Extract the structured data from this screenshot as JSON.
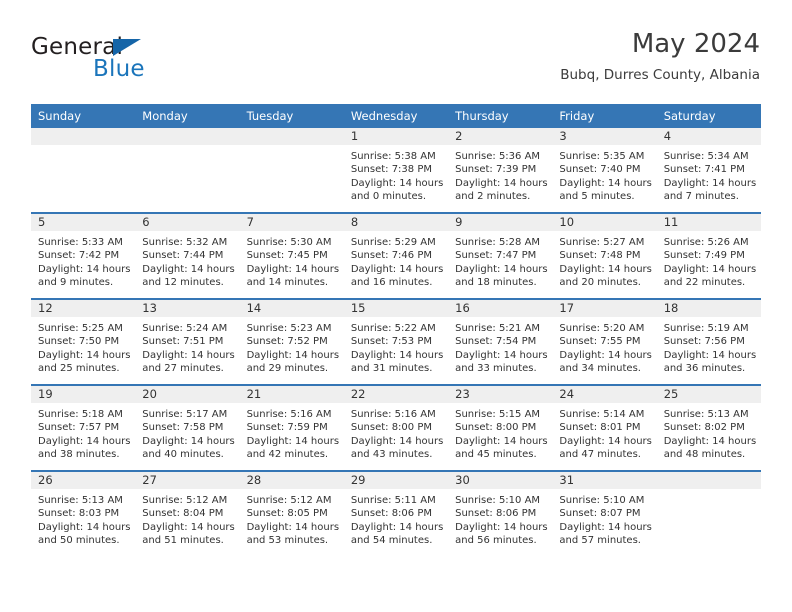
{
  "logo": {
    "word_one": "General",
    "word_two": "Blue",
    "triangle_color": "#1565a8",
    "blue_color": "#1b75bb"
  },
  "header": {
    "title": "May 2024",
    "subtitle": "Bubq, Durres County, Albania"
  },
  "theme": {
    "header_blue": "#3576b5",
    "daynum_gray": "#efefef",
    "text_color": "#333333"
  },
  "weekday_headers": [
    "Sunday",
    "Monday",
    "Tuesday",
    "Wednesday",
    "Thursday",
    "Friday",
    "Saturday"
  ],
  "weeks": [
    [
      {
        "day": "",
        "empty": true
      },
      {
        "day": "",
        "empty": true
      },
      {
        "day": "",
        "empty": true
      },
      {
        "day": "1",
        "sunrise": "Sunrise: 5:38 AM",
        "sunset": "Sunset: 7:38 PM",
        "daylight_line1": "Daylight: 14 hours",
        "daylight_line2": "and 0 minutes."
      },
      {
        "day": "2",
        "sunrise": "Sunrise: 5:36 AM",
        "sunset": "Sunset: 7:39 PM",
        "daylight_line1": "Daylight: 14 hours",
        "daylight_line2": "and 2 minutes."
      },
      {
        "day": "3",
        "sunrise": "Sunrise: 5:35 AM",
        "sunset": "Sunset: 7:40 PM",
        "daylight_line1": "Daylight: 14 hours",
        "daylight_line2": "and 5 minutes."
      },
      {
        "day": "4",
        "sunrise": "Sunrise: 5:34 AM",
        "sunset": "Sunset: 7:41 PM",
        "daylight_line1": "Daylight: 14 hours",
        "daylight_line2": "and 7 minutes."
      }
    ],
    [
      {
        "day": "5",
        "sunrise": "Sunrise: 5:33 AM",
        "sunset": "Sunset: 7:42 PM",
        "daylight_line1": "Daylight: 14 hours",
        "daylight_line2": "and 9 minutes."
      },
      {
        "day": "6",
        "sunrise": "Sunrise: 5:32 AM",
        "sunset": "Sunset: 7:44 PM",
        "daylight_line1": "Daylight: 14 hours",
        "daylight_line2": "and 12 minutes."
      },
      {
        "day": "7",
        "sunrise": "Sunrise: 5:30 AM",
        "sunset": "Sunset: 7:45 PM",
        "daylight_line1": "Daylight: 14 hours",
        "daylight_line2": "and 14 minutes."
      },
      {
        "day": "8",
        "sunrise": "Sunrise: 5:29 AM",
        "sunset": "Sunset: 7:46 PM",
        "daylight_line1": "Daylight: 14 hours",
        "daylight_line2": "and 16 minutes."
      },
      {
        "day": "9",
        "sunrise": "Sunrise: 5:28 AM",
        "sunset": "Sunset: 7:47 PM",
        "daylight_line1": "Daylight: 14 hours",
        "daylight_line2": "and 18 minutes."
      },
      {
        "day": "10",
        "sunrise": "Sunrise: 5:27 AM",
        "sunset": "Sunset: 7:48 PM",
        "daylight_line1": "Daylight: 14 hours",
        "daylight_line2": "and 20 minutes."
      },
      {
        "day": "11",
        "sunrise": "Sunrise: 5:26 AM",
        "sunset": "Sunset: 7:49 PM",
        "daylight_line1": "Daylight: 14 hours",
        "daylight_line2": "and 22 minutes."
      }
    ],
    [
      {
        "day": "12",
        "sunrise": "Sunrise: 5:25 AM",
        "sunset": "Sunset: 7:50 PM",
        "daylight_line1": "Daylight: 14 hours",
        "daylight_line2": "and 25 minutes."
      },
      {
        "day": "13",
        "sunrise": "Sunrise: 5:24 AM",
        "sunset": "Sunset: 7:51 PM",
        "daylight_line1": "Daylight: 14 hours",
        "daylight_line2": "and 27 minutes."
      },
      {
        "day": "14",
        "sunrise": "Sunrise: 5:23 AM",
        "sunset": "Sunset: 7:52 PM",
        "daylight_line1": "Daylight: 14 hours",
        "daylight_line2": "and 29 minutes."
      },
      {
        "day": "15",
        "sunrise": "Sunrise: 5:22 AM",
        "sunset": "Sunset: 7:53 PM",
        "daylight_line1": "Daylight: 14 hours",
        "daylight_line2": "and 31 minutes."
      },
      {
        "day": "16",
        "sunrise": "Sunrise: 5:21 AM",
        "sunset": "Sunset: 7:54 PM",
        "daylight_line1": "Daylight: 14 hours",
        "daylight_line2": "and 33 minutes."
      },
      {
        "day": "17",
        "sunrise": "Sunrise: 5:20 AM",
        "sunset": "Sunset: 7:55 PM",
        "daylight_line1": "Daylight: 14 hours",
        "daylight_line2": "and 34 minutes."
      },
      {
        "day": "18",
        "sunrise": "Sunrise: 5:19 AM",
        "sunset": "Sunset: 7:56 PM",
        "daylight_line1": "Daylight: 14 hours",
        "daylight_line2": "and 36 minutes."
      }
    ],
    [
      {
        "day": "19",
        "sunrise": "Sunrise: 5:18 AM",
        "sunset": "Sunset: 7:57 PM",
        "daylight_line1": "Daylight: 14 hours",
        "daylight_line2": "and 38 minutes."
      },
      {
        "day": "20",
        "sunrise": "Sunrise: 5:17 AM",
        "sunset": "Sunset: 7:58 PM",
        "daylight_line1": "Daylight: 14 hours",
        "daylight_line2": "and 40 minutes."
      },
      {
        "day": "21",
        "sunrise": "Sunrise: 5:16 AM",
        "sunset": "Sunset: 7:59 PM",
        "daylight_line1": "Daylight: 14 hours",
        "daylight_line2": "and 42 minutes."
      },
      {
        "day": "22",
        "sunrise": "Sunrise: 5:16 AM",
        "sunset": "Sunset: 8:00 PM",
        "daylight_line1": "Daylight: 14 hours",
        "daylight_line2": "and 43 minutes."
      },
      {
        "day": "23",
        "sunrise": "Sunrise: 5:15 AM",
        "sunset": "Sunset: 8:00 PM",
        "daylight_line1": "Daylight: 14 hours",
        "daylight_line2": "and 45 minutes."
      },
      {
        "day": "24",
        "sunrise": "Sunrise: 5:14 AM",
        "sunset": "Sunset: 8:01 PM",
        "daylight_line1": "Daylight: 14 hours",
        "daylight_line2": "and 47 minutes."
      },
      {
        "day": "25",
        "sunrise": "Sunrise: 5:13 AM",
        "sunset": "Sunset: 8:02 PM",
        "daylight_line1": "Daylight: 14 hours",
        "daylight_line2": "and 48 minutes."
      }
    ],
    [
      {
        "day": "26",
        "sunrise": "Sunrise: 5:13 AM",
        "sunset": "Sunset: 8:03 PM",
        "daylight_line1": "Daylight: 14 hours",
        "daylight_line2": "and 50 minutes."
      },
      {
        "day": "27",
        "sunrise": "Sunrise: 5:12 AM",
        "sunset": "Sunset: 8:04 PM",
        "daylight_line1": "Daylight: 14 hours",
        "daylight_line2": "and 51 minutes."
      },
      {
        "day": "28",
        "sunrise": "Sunrise: 5:12 AM",
        "sunset": "Sunset: 8:05 PM",
        "daylight_line1": "Daylight: 14 hours",
        "daylight_line2": "and 53 minutes."
      },
      {
        "day": "29",
        "sunrise": "Sunrise: 5:11 AM",
        "sunset": "Sunset: 8:06 PM",
        "daylight_line1": "Daylight: 14 hours",
        "daylight_line2": "and 54 minutes."
      },
      {
        "day": "30",
        "sunrise": "Sunrise: 5:10 AM",
        "sunset": "Sunset: 8:06 PM",
        "daylight_line1": "Daylight: 14 hours",
        "daylight_line2": "and 56 minutes."
      },
      {
        "day": "31",
        "sunrise": "Sunrise: 5:10 AM",
        "sunset": "Sunset: 8:07 PM",
        "daylight_line1": "Daylight: 14 hours",
        "daylight_line2": "and 57 minutes."
      },
      {
        "day": "",
        "empty": true
      }
    ]
  ]
}
